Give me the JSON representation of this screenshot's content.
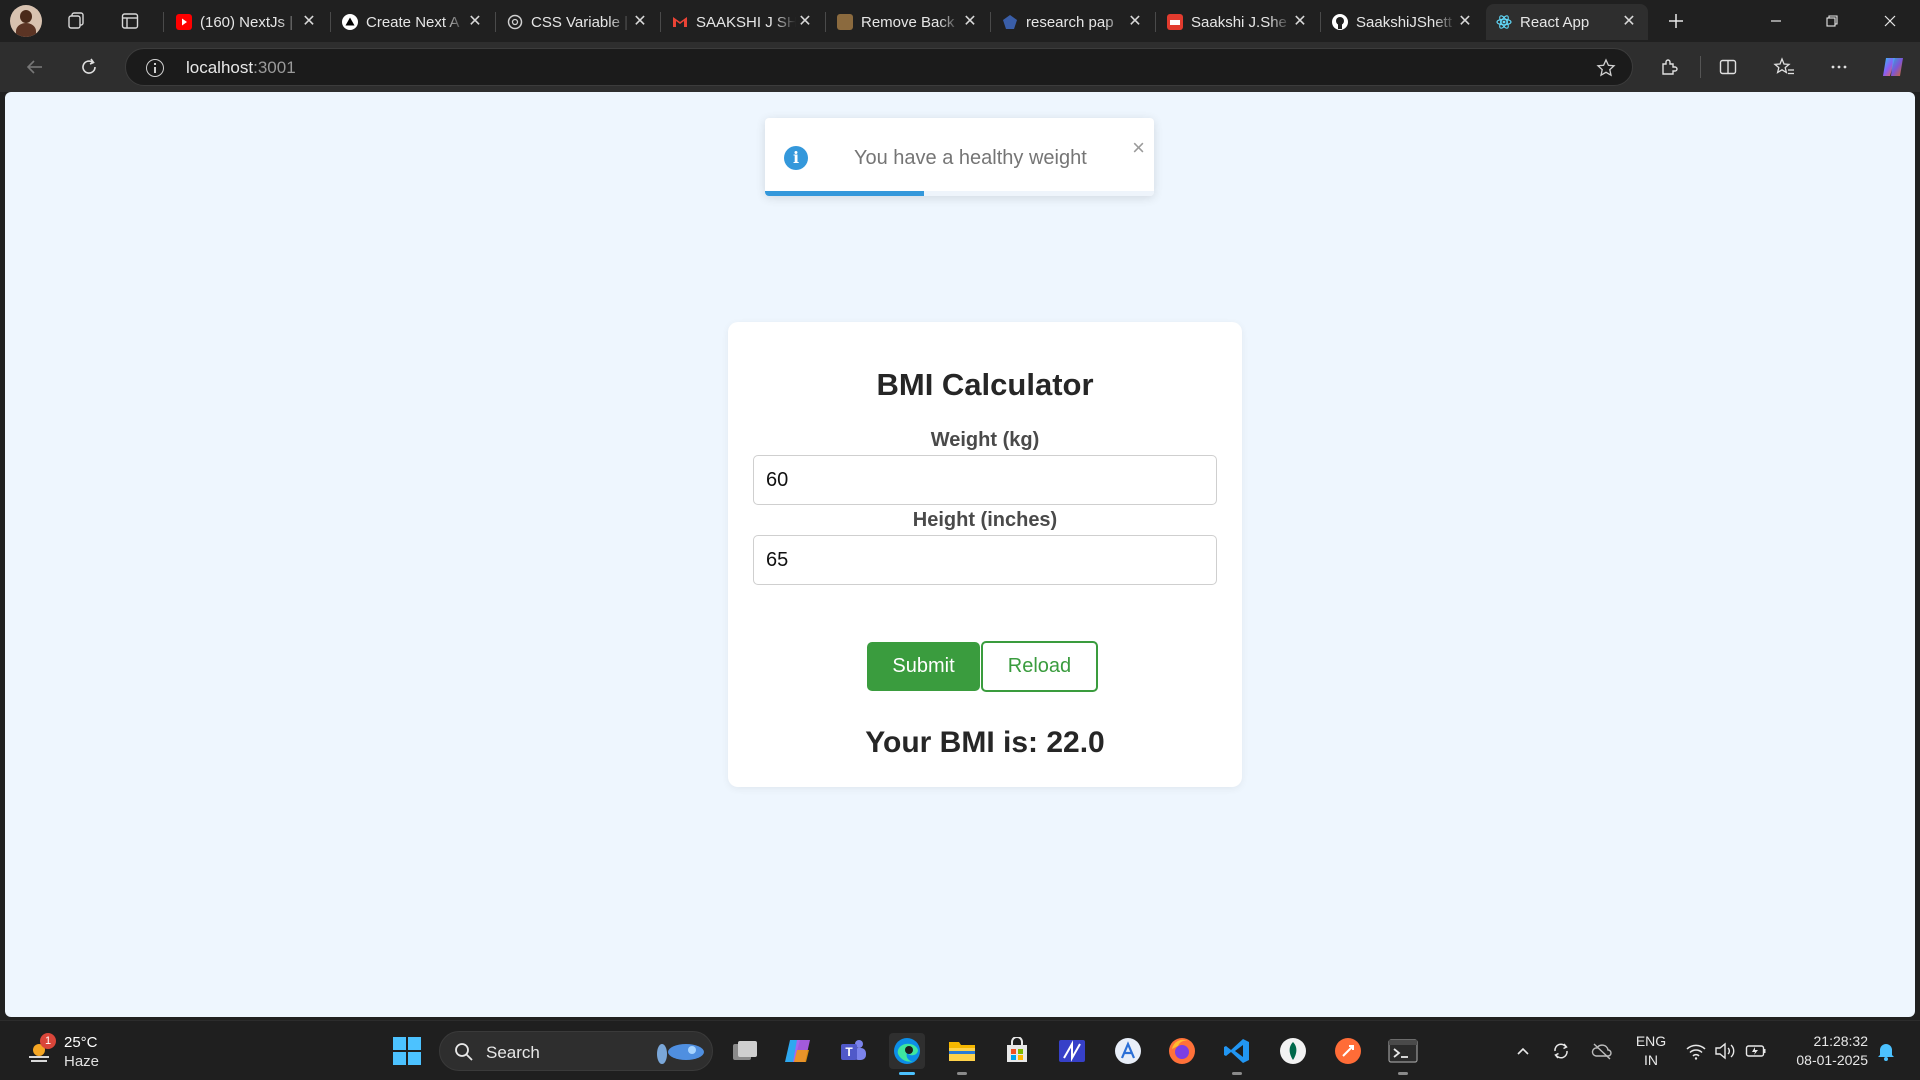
{
  "browser": {
    "tabs": [
      {
        "title": "(160) NextJs |",
        "favicon": "youtube-icon",
        "color": "#ff0000"
      },
      {
        "title": "Create Next A",
        "favicon": "vercel-icon",
        "color": "#ffffff"
      },
      {
        "title": "CSS Variable |",
        "favicon": "chatgpt-icon",
        "color": "#cfcfcf"
      },
      {
        "title": "SAAKSHI J SH",
        "favicon": "gmail-icon",
        "color": "#ea4335"
      },
      {
        "title": "Remove Back",
        "favicon": "remove-bg-icon",
        "color": "#8b6a3e"
      },
      {
        "title": "research pap",
        "favicon": "research-icon",
        "color": "#3a5ea8"
      },
      {
        "title": "Saakshi J.She",
        "favicon": "pdf-icon",
        "color": "#e23b2e"
      },
      {
        "title": "SaakshiJShett",
        "favicon": "github-icon",
        "color": "#ffffff"
      },
      {
        "title": "React App",
        "favicon": "react-icon",
        "color": "#61dafb",
        "active": true
      }
    ],
    "address": {
      "host": "localhost",
      "port": ":3001"
    }
  },
  "toast": {
    "message": "You have a healthy weight",
    "close_glyph": "×",
    "progress": 0.41,
    "accent": "#3498db"
  },
  "calculator": {
    "title": "BMI Calculator",
    "weight_label": "Weight (kg)",
    "weight_value": "60",
    "height_label": "Height (inches)",
    "height_value": "65",
    "submit_label": "Submit",
    "reload_label": "Reload",
    "result_text": "Your BMI is: 22.0",
    "accent": "#3a9c3e"
  },
  "taskbar": {
    "weather": {
      "temp": "25°C",
      "condition": "Haze",
      "badge": "1"
    },
    "search_label": "Search",
    "language": {
      "line1": "ENG",
      "line2": "IN"
    },
    "clock": {
      "time": "21:28:32",
      "date": "08-01-2025"
    }
  }
}
